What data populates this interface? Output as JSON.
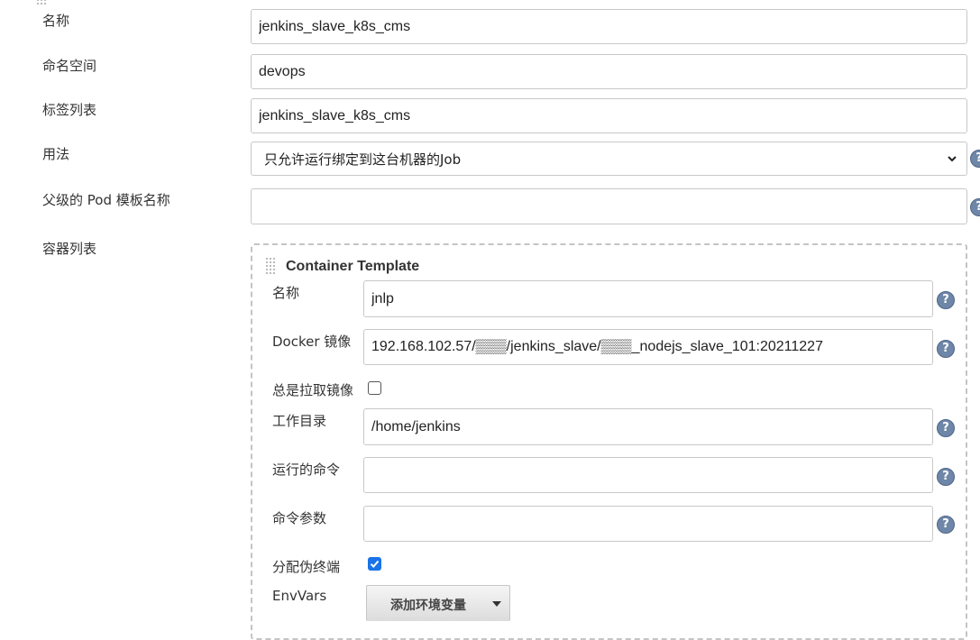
{
  "outer_form": {
    "name": {
      "label": "名称",
      "value": "jenkins_slave_k8s_cms"
    },
    "namespace": {
      "label": "命名空间",
      "value": "devops"
    },
    "labels": {
      "label": "标签列表",
      "value": "jenkins_slave_k8s_cms"
    },
    "usage": {
      "label": "用法",
      "selected": "只允许运行绑定到这台机器的Job"
    },
    "parent_pod": {
      "label": "父级的 Pod 模板名称",
      "value": ""
    },
    "containers": {
      "label": "容器列表"
    }
  },
  "container_template": {
    "title": "Container Template",
    "name": {
      "label": "名称",
      "value": "jnlp"
    },
    "docker_image": {
      "label": "Docker 镜像",
      "value": "192.168.102.57/▒▒▒/jenkins_slave/▒▒▒_nodejs_slave_101:20211227"
    },
    "always_pull": {
      "label": "总是拉取镜像",
      "checked": false
    },
    "working_dir": {
      "label": "工作目录",
      "value": "/home/jenkins"
    },
    "command": {
      "label": "运行的命令",
      "value": ""
    },
    "args": {
      "label": "命令参数",
      "value": ""
    },
    "tty": {
      "label": "分配伪终端",
      "checked": true
    },
    "env_vars": {
      "label": "EnvVars",
      "add_button": "添加环境变量"
    }
  },
  "help_glyph": "?",
  "colors": {
    "accent": "#1a73e8",
    "help_icon": "#6e87a8",
    "border": "#c8c8c8"
  },
  "icons": [
    "help-icon",
    "chevron-down-icon",
    "drag-handle-icon",
    "caret-down-icon"
  ]
}
